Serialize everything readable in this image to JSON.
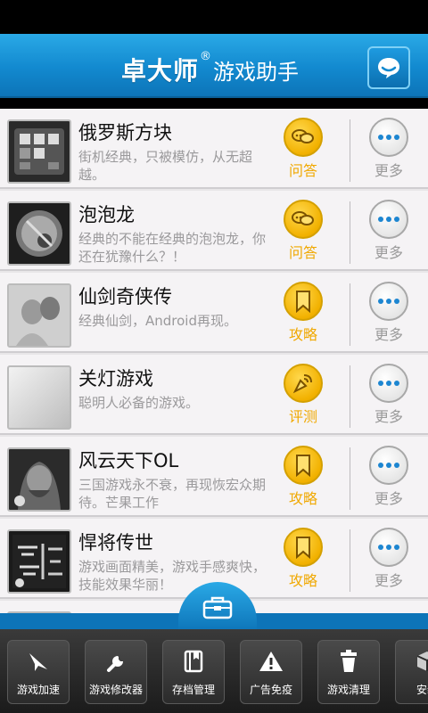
{
  "header": {
    "brand": "卓大师",
    "registered_mark": "®",
    "subtitle": "游戏助手",
    "action_icon": "chat-bubble-icon"
  },
  "games": [
    {
      "title": "俄罗斯方块",
      "desc": "街机经典，只被模仿，从无超越。",
      "action": "问答",
      "action_icon": "qa-bubble-icon",
      "more": "更多"
    },
    {
      "title": "泡泡龙",
      "desc": "经典的不能在经典的泡泡龙，你还在犹豫什么？！",
      "action": "问答",
      "action_icon": "qa-bubble-icon",
      "more": "更多"
    },
    {
      "title": "仙剑奇侠传",
      "desc": "经典仙剑，Android再现。",
      "action": "攻略",
      "action_icon": "bookmark-icon",
      "more": "更多"
    },
    {
      "title": "关灯游戏",
      "desc": "聪明人必备的游戏。",
      "action": "评测",
      "action_icon": "review-icon",
      "more": "更多"
    },
    {
      "title": "风云天下OL",
      "desc": "三国游戏永不衰，再现恢宏众期待。芒果工作",
      "action": "攻略",
      "action_icon": "bookmark-icon",
      "more": "更多"
    },
    {
      "title": "悍将传世",
      "desc": "游戏画面精美，游戏手感爽快，技能效果华丽！",
      "action": "攻略",
      "action_icon": "bookmark-icon",
      "more": "更多"
    }
  ],
  "dock": {
    "toggle_icon": "toolbox-icon",
    "items": [
      {
        "label": "游戏加速",
        "icon": "paper-plane-icon"
      },
      {
        "label": "游戏修改器",
        "icon": "wrench-icon"
      },
      {
        "label": "存档管理",
        "icon": "book-icon"
      },
      {
        "label": "广告免疫",
        "icon": "warning-icon"
      },
      {
        "label": "游戏清理",
        "icon": "trash-icon"
      },
      {
        "label": "安装",
        "icon": "package-icon"
      }
    ]
  },
  "colors": {
    "header_blue": "#1289cf",
    "action_orange": "#f0a800",
    "more_blue": "#1c86d1"
  }
}
